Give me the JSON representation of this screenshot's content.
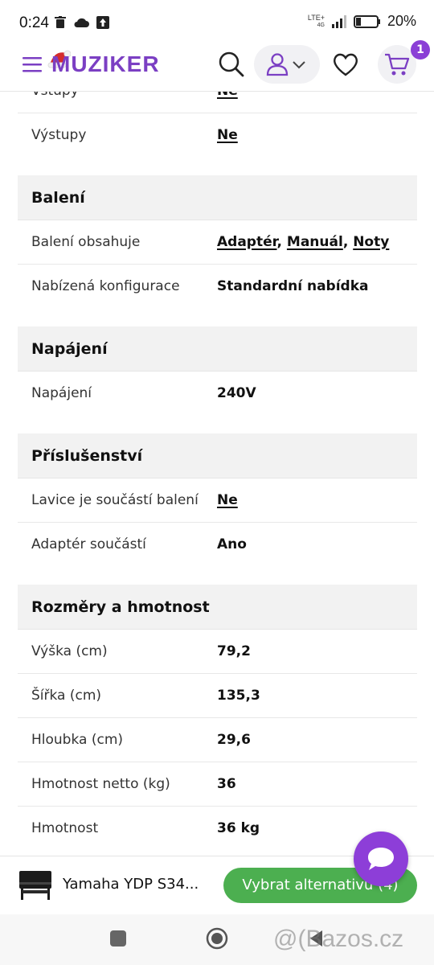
{
  "status_bar": {
    "time": "0:24",
    "network": "LTE+",
    "network_sub": "4G",
    "battery": "20%",
    "icons": [
      "trash-icon",
      "cloud-icon",
      "upload-icon",
      "signal-icon",
      "battery-icon"
    ]
  },
  "header": {
    "logo": "MUZIKER",
    "cart_count": "1",
    "brand_color": "#7b3fc3",
    "icons": [
      "menu-icon",
      "search-icon",
      "user-icon",
      "chevron-down-icon",
      "heart-icon",
      "cart-icon"
    ]
  },
  "spec_top": [
    {
      "label": "Vstupy",
      "value": "Ne",
      "link": true
    },
    {
      "label": "Výstupy",
      "value": "Ne",
      "link": true
    }
  ],
  "sections": [
    {
      "title": "Balení",
      "rows": [
        {
          "label": "Balení obsahuje",
          "links": [
            "Adaptér",
            "Manuál",
            "Noty"
          ]
        },
        {
          "label": "Nabízená konfigurace",
          "value": "Standardní nabídka"
        }
      ]
    },
    {
      "title": "Napájení",
      "rows": [
        {
          "label": "Napájení",
          "value": "240V"
        }
      ]
    },
    {
      "title": "Příslušenství",
      "rows": [
        {
          "label": "Lavice je součástí balení",
          "value": "Ne",
          "link": true
        },
        {
          "label": "Adaptér součástí",
          "value": "Ano"
        }
      ]
    },
    {
      "title": "Rozměry a hmotnost",
      "rows": [
        {
          "label": "Výška (cm)",
          "value": "79,2"
        },
        {
          "label": "Šířka (cm)",
          "value": "135,3"
        },
        {
          "label": "Hloubka (cm)",
          "value": "29,6"
        },
        {
          "label": "Hmotnost netto (kg)",
          "value": "36"
        },
        {
          "label": "Hmotnost",
          "value": "36 kg"
        }
      ]
    }
  ],
  "bottom_bar": {
    "product_name": "Yamaha YDP S34...",
    "alt_button": "Vybrat alternativu (4)",
    "button_color": "#4caf50",
    "chat_color": "#8d3ed8"
  },
  "watermark": "@(Bazos.cz"
}
